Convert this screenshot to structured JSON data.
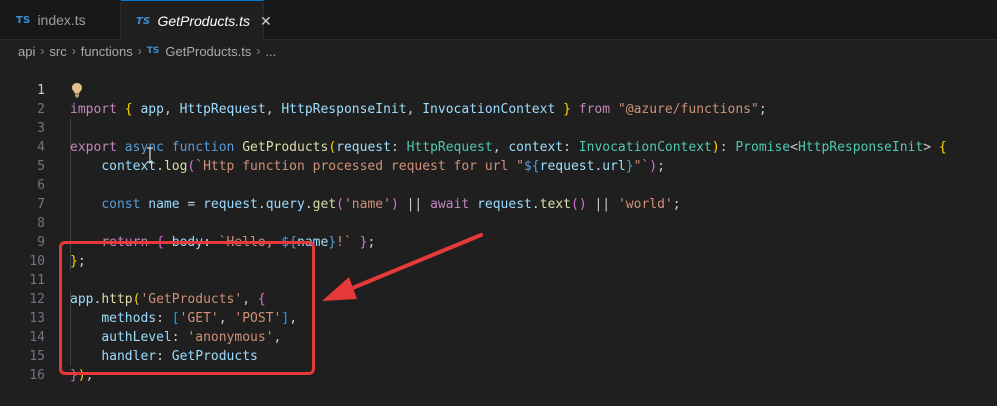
{
  "tabs": [
    {
      "badge": "TS",
      "label": "index.ts",
      "active": false
    },
    {
      "badge": "TS",
      "label": "GetProducts.ts",
      "active": true,
      "close": "✕"
    }
  ],
  "breadcrumb": {
    "items": [
      "api",
      "src",
      "functions"
    ],
    "file_badge": "TS",
    "file": "GetProducts.ts",
    "more": "..."
  },
  "colors": {
    "highlight_box": "#e5393a",
    "arrow": "#e5393a",
    "active_tab_border": "#0078d4"
  },
  "code": {
    "active_line": 1,
    "lines": [
      {
        "n": "1"
      },
      {
        "n": "2"
      },
      {
        "n": "3"
      },
      {
        "n": "4"
      },
      {
        "n": "5"
      },
      {
        "n": "6"
      },
      {
        "n": "7"
      },
      {
        "n": "8"
      },
      {
        "n": "9"
      },
      {
        "n": "10"
      },
      {
        "n": "11"
      },
      {
        "n": "12"
      },
      {
        "n": "13"
      },
      {
        "n": "14"
      },
      {
        "n": "15"
      },
      {
        "n": "16"
      }
    ]
  }
}
